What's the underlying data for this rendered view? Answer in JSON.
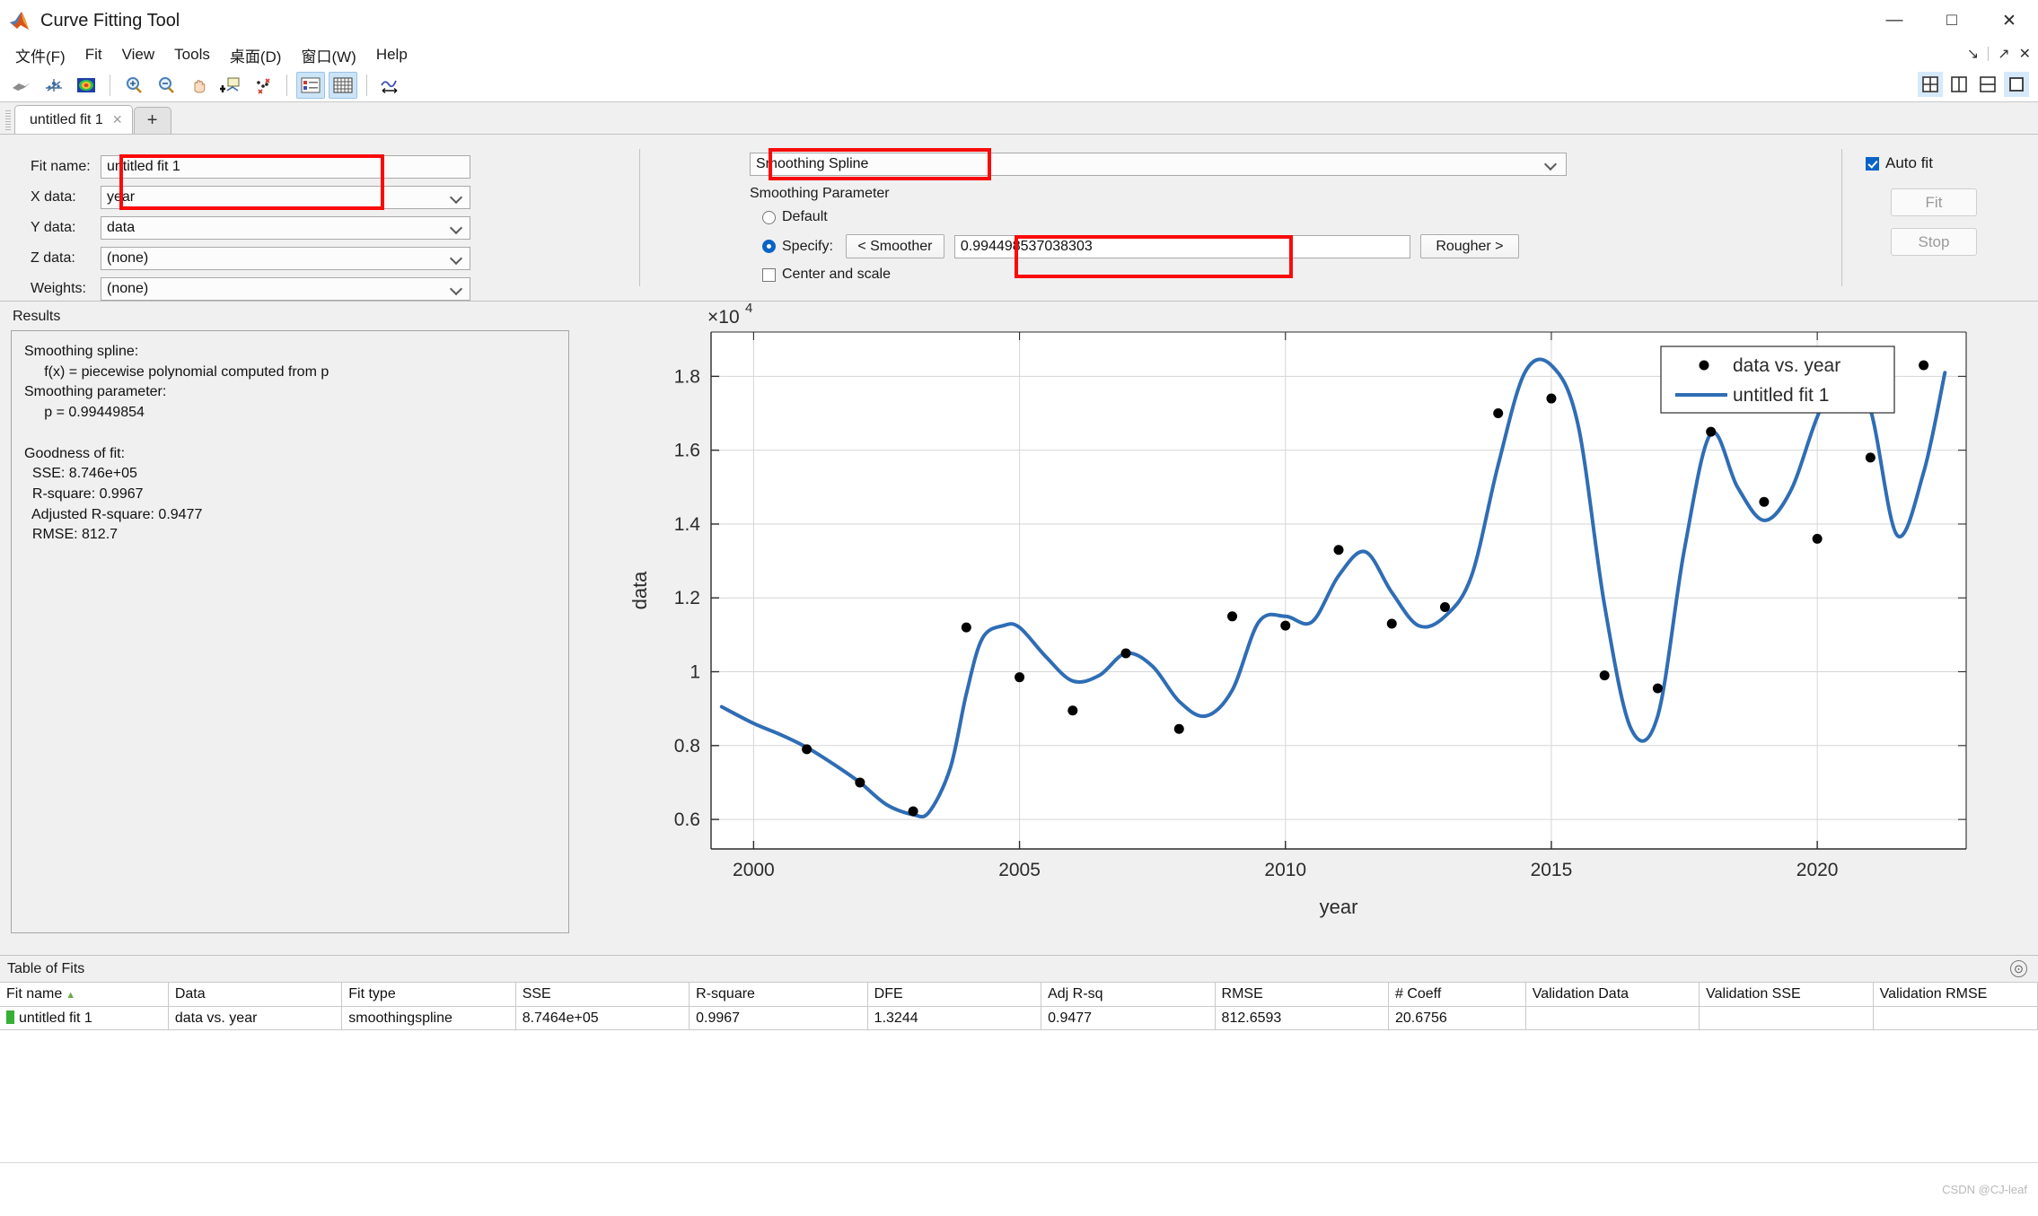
{
  "window": {
    "title": "Curve Fitting Tool",
    "minimize": "—",
    "maximize": "□",
    "close": "✕"
  },
  "menu": {
    "items": [
      {
        "label": "文件(F)",
        "name": "menu-file"
      },
      {
        "label": "Fit",
        "name": "menu-fit"
      },
      {
        "label": "View",
        "name": "menu-view"
      },
      {
        "label": "Tools",
        "name": "menu-tools"
      },
      {
        "label": "桌面(D)",
        "name": "menu-desktop"
      },
      {
        "label": "窗口(W)",
        "name": "menu-window"
      },
      {
        "label": "Help",
        "name": "menu-help"
      }
    ],
    "dock": {
      "undock": "↘",
      "popout": "↗",
      "close": "✕"
    }
  },
  "toolbar": {
    "buttons": [
      "surface-icon",
      "axes-icon",
      "contour-icon",
      "zoom-in-icon",
      "zoom-out-icon",
      "pan-icon",
      "data-cursor-icon",
      "exclude-outliers-icon",
      "legend-icon",
      "grid-icon",
      "axes-limits-icon"
    ],
    "layout": [
      "layout-quad-icon",
      "layout-vertical-icon",
      "layout-horizontal-icon",
      "layout-single-icon"
    ]
  },
  "tabs": {
    "active": "untitled fit 1",
    "close_glyph": "✕",
    "add_glyph": "+"
  },
  "fit_config": {
    "fields": [
      {
        "label": "Fit name:",
        "value": "untitled fit 1",
        "combo": false,
        "name": "fit-name-input"
      },
      {
        "label": "X data:",
        "value": "year",
        "combo": true,
        "name": "x-data-select"
      },
      {
        "label": "Y data:",
        "value": "data",
        "combo": true,
        "name": "y-data-select"
      },
      {
        "label": "Z data:",
        "value": "(none)",
        "combo": true,
        "name": "z-data-select"
      },
      {
        "label": "Weights:",
        "value": "(none)",
        "combo": true,
        "name": "weights-select"
      }
    ],
    "fit_type": "Smoothing Spline",
    "smoothing_parameter_title": "Smoothing Parameter",
    "default_label": "Default",
    "specify_label": "Specify:",
    "smoother_button": "< Smoother",
    "rougher_button": "Rougher >",
    "smoothing_value": "0.994498537038303",
    "center_scale_label": "Center and scale",
    "default_selected": false,
    "specify_selected": true,
    "center_scale_checked": false
  },
  "fit_actions": {
    "auto_fit_label": "Auto fit",
    "auto_fit_checked": true,
    "fit_button": "Fit",
    "stop_button": "Stop"
  },
  "results": {
    "title": "Results",
    "text": "Smoothing spline:\n     f(x) = piecewise polynomial computed from p\nSmoothing parameter:\n     p = 0.99449854\n\nGoodness of fit:\n  SSE: 8.746e+05\n  R-square: 0.9967\n  Adjusted R-square: 0.9477\n  RMSE: 812.7"
  },
  "table_of_fits": {
    "title": "Table of Fits",
    "collapse_glyph": "⊙",
    "columns": [
      "Fit name",
      "Data",
      "Fit type",
      "SSE",
      "R-square",
      "DFE",
      "Adj R-sq",
      "RMSE",
      "# Coeff",
      "Validation Data",
      "Validation SSE",
      "Validation RMSE"
    ],
    "sort_column": "Fit name",
    "sort_arrow": "▲",
    "rows": [
      {
        "fit_name": "untitled fit 1",
        "data": "data vs. year",
        "fit_type": "smoothingspline",
        "sse": "8.7464e+05",
        "r_square": "0.9967",
        "dfe": "1.3244",
        "adj_r_sq": "0.9477",
        "rmse": "812.6593",
        "n_coeff": "20.6756",
        "validation_data": "",
        "validation_sse": "",
        "validation_rmse": ""
      }
    ]
  },
  "watermark": "CSDN @CJ-leaf",
  "colors": {
    "fit_line": "#2f6db5",
    "data_point": "#000000",
    "highlight": "#fa0a0a",
    "accent": "#0a64c8",
    "panel_bg": "#f0f0f0"
  },
  "chart_data": {
    "type": "scatter",
    "title": "",
    "xlabel": "year",
    "ylabel": "data",
    "y_multiplier": "×10",
    "y_multiplier_exp": "4",
    "xlim": [
      1999.2,
      2022.8
    ],
    "ylim": [
      5200,
      19200
    ],
    "xticks": [
      2000,
      2005,
      2010,
      2015,
      2020
    ],
    "yticks": [
      0.6,
      0.8,
      1.0,
      1.2,
      1.4,
      1.6,
      1.8
    ],
    "ytick_labels": [
      "0.6",
      "0.8",
      "1",
      "1.2",
      "1.4",
      "1.6",
      "1.8"
    ],
    "grid": true,
    "legend_position": "top-right",
    "legend": [
      {
        "label": "data vs. year",
        "marker": "dot",
        "color": "#000000"
      },
      {
        "label": "untitled fit 1",
        "marker": "line",
        "color": "#2f6db5"
      }
    ],
    "series": [
      {
        "name": "data vs. year",
        "type": "scatter",
        "x": [
          2001,
          2002,
          2003,
          2004,
          2005,
          2006,
          2007,
          2008,
          2009,
          2010,
          2011,
          2012,
          2013,
          2014,
          2015,
          2016,
          2017,
          2018,
          2019,
          2020,
          2021,
          2022
        ],
        "y": [
          7900,
          7000,
          6220,
          11200,
          9850,
          8950,
          10500,
          8450,
          11500,
          11250,
          13300,
          11300,
          11750,
          17000,
          17400,
          9900,
          9550,
          16500,
          14600,
          13600,
          15800,
          18300
        ]
      },
      {
        "name": "untitled fit 1",
        "type": "line",
        "x": [
          1999.4,
          2000,
          2000.5,
          2001,
          2001.5,
          2002,
          2002.5,
          2003,
          2003.3,
          2003.7,
          2004,
          2004.3,
          2004.7,
          2005,
          2005.5,
          2006,
          2006.5,
          2007,
          2007.5,
          2008,
          2008.5,
          2009,
          2009.5,
          2010,
          2010.5,
          2011,
          2011.5,
          2012,
          2012.5,
          2013,
          2013.5,
          2014,
          2014.5,
          2015,
          2015.5,
          2016,
          2016.5,
          2017,
          2017.5,
          2018,
          2018.5,
          2019,
          2019.5,
          2020,
          2020.5,
          2021,
          2021.5,
          2022,
          2022.4
        ],
        "y": [
          9050,
          8600,
          8300,
          7950,
          7500,
          7000,
          6400,
          6130,
          6200,
          7400,
          9400,
          10900,
          11250,
          11200,
          10400,
          9750,
          9900,
          10500,
          10150,
          9200,
          8800,
          9500,
          11350,
          11500,
          11350,
          12600,
          13250,
          12150,
          11250,
          11500,
          12600,
          15600,
          18100,
          18300,
          16700,
          11800,
          8450,
          8800,
          13300,
          16450,
          15000,
          14100,
          14900,
          16900,
          18400,
          17100,
          13700,
          15400,
          18100
        ]
      }
    ]
  }
}
